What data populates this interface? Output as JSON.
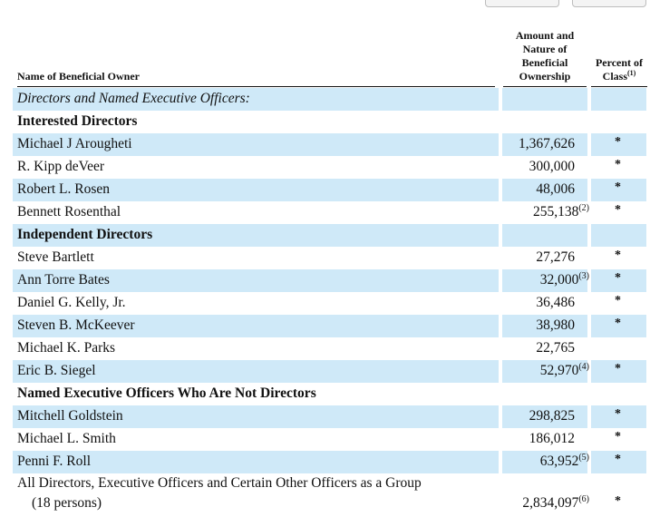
{
  "headers": {
    "name": "Name of Beneficial Owner",
    "amount": [
      "Amount and",
      "Nature of",
      "Beneficial",
      "Ownership"
    ],
    "percent": [
      "Percent of",
      "Class"
    ],
    "percent_footnote": "(1)"
  },
  "rows": [
    {
      "name": "Directors and Named Executive Officers:",
      "kind": "italic",
      "shade": true,
      "amount": "",
      "fn": "",
      "pct": ""
    },
    {
      "name": "Interested Directors",
      "kind": "section",
      "shade": false,
      "amount": "",
      "fn": "",
      "pct": ""
    },
    {
      "name": "Michael J Arougheti",
      "kind": "person",
      "shade": true,
      "amount": "1,367,626",
      "fn": "",
      "pct": "*"
    },
    {
      "name": "R. Kipp deVeer",
      "kind": "person",
      "shade": false,
      "amount": "300,000",
      "fn": "",
      "pct": "*"
    },
    {
      "name": "Robert L. Rosen",
      "kind": "person",
      "shade": true,
      "amount": "48,006",
      "fn": "",
      "pct": "*"
    },
    {
      "name": "Bennett Rosenthal",
      "kind": "person",
      "shade": false,
      "amount": "255,138",
      "fn": "(2)",
      "pct": "*"
    },
    {
      "name": "Independent Directors",
      "kind": "section",
      "shade": true,
      "amount": "",
      "fn": "",
      "pct": ""
    },
    {
      "name": "Steve Bartlett",
      "kind": "person",
      "shade": false,
      "amount": "27,276",
      "fn": "",
      "pct": "*"
    },
    {
      "name": "Ann Torre Bates",
      "kind": "person",
      "shade": true,
      "amount": "32,000",
      "fn": "(3)",
      "pct": "*"
    },
    {
      "name": "Daniel G. Kelly, Jr.",
      "kind": "person",
      "shade": false,
      "amount": "36,486",
      "fn": "",
      "pct": "*"
    },
    {
      "name": "Steven B. McKeever",
      "kind": "person",
      "shade": true,
      "amount": "38,980",
      "fn": "",
      "pct": "*"
    },
    {
      "name": "Michael K. Parks",
      "kind": "person",
      "shade": false,
      "amount": "22,765",
      "fn": "",
      "pct": ""
    },
    {
      "name": "Eric B. Siegel",
      "kind": "person",
      "shade": true,
      "amount": "52,970",
      "fn": "(4)",
      "pct": "*"
    },
    {
      "name": "Named Executive Officers Who Are Not Directors",
      "kind": "section",
      "shade": false,
      "amount": "",
      "fn": "",
      "pct": ""
    },
    {
      "name": "Mitchell Goldstein",
      "kind": "person",
      "shade": true,
      "amount": "298,825",
      "fn": "",
      "pct": "*"
    },
    {
      "name": "Michael L. Smith",
      "kind": "person",
      "shade": false,
      "amount": "186,012",
      "fn": "",
      "pct": "*"
    },
    {
      "name": "Penni F. Roll",
      "kind": "person",
      "shade": true,
      "amount": "63,952",
      "fn": "(5)",
      "pct": "*"
    }
  ],
  "group": {
    "line1": "All Directors, Executive Officers and Certain Other Officers as a Group",
    "line2": "(18 persons)",
    "amount": "2,834,097",
    "fn": "(6)",
    "pct": "*"
  }
}
